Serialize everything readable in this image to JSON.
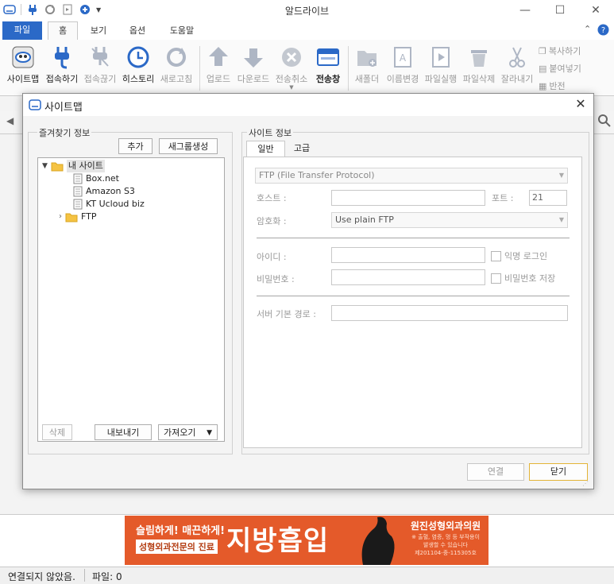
{
  "window": {
    "title": "알드라이브",
    "min_symbol": "—",
    "max_symbol": "☐",
    "close_symbol": "✕"
  },
  "ribbon_tabs": [
    {
      "label": "파일"
    },
    {
      "label": "홈"
    },
    {
      "label": "보기"
    },
    {
      "label": "옵션"
    },
    {
      "label": "도움말"
    }
  ],
  "ribbon": {
    "sitemap": "사이트맵",
    "connect": "접속하기",
    "disconnect": "접속끊기",
    "history": "히스토리",
    "refresh": "새로고침",
    "upload": "업로드",
    "download": "다운로드",
    "cancel_transfer": "전송취소",
    "transfer_window": "전송창",
    "new_folder": "새폴더",
    "rename": "이름변경",
    "run_file": "파일실행",
    "delete_file": "파일삭제",
    "cut": "잘라내기",
    "copy": "복사하기",
    "paste": "붙여넣기",
    "invert": "반전"
  },
  "dialog": {
    "title": "사이트맵",
    "favorites_group": "즐겨찾기 정보",
    "add_button": "추가",
    "new_group_button": "새그룹생성",
    "tree": {
      "root": "내 사이트",
      "items": [
        "Box.net",
        "Amazon S3",
        "KT Ucloud biz"
      ],
      "ftp_folder": "FTP"
    },
    "delete_button": "삭제",
    "export_button": "내보내기",
    "import_button": "가져오기",
    "site_info_group": "사이트 정보",
    "tabs": [
      {
        "label": "일반"
      },
      {
        "label": "고급"
      }
    ],
    "protocol": "FTP (File Transfer Protocol)",
    "host_label": "호스트 :",
    "host_value": "",
    "port_label": "포트 :",
    "port_value": "21",
    "encryption_label": "암호화 :",
    "encryption_value": "Use plain FTP",
    "id_label": "아이디 :",
    "anonymous_login": "익명 로그인",
    "password_label": "비밀번호 :",
    "save_password": "비밀번호 저장",
    "server_path_label": "서버 기본 경로 :",
    "connect_button": "연결",
    "close_button": "닫기"
  },
  "ad": {
    "headline": "슬림하게! 매끈하게!",
    "tagline": "성형외과전문의 진료",
    "big_text": "지방흡입",
    "clinic": "원진성형외과의원",
    "note1": "※ 출혈, 염증, 멍 등 부작용이",
    "note2": "발생할 수 있습니다",
    "reg": "제201104-중-115305호"
  },
  "status": {
    "connection": "연결되지 않았음.",
    "files": "파일: 0"
  },
  "colors": {
    "file_tab": "#2b69c7",
    "ad_bg": "#e45a2a"
  }
}
